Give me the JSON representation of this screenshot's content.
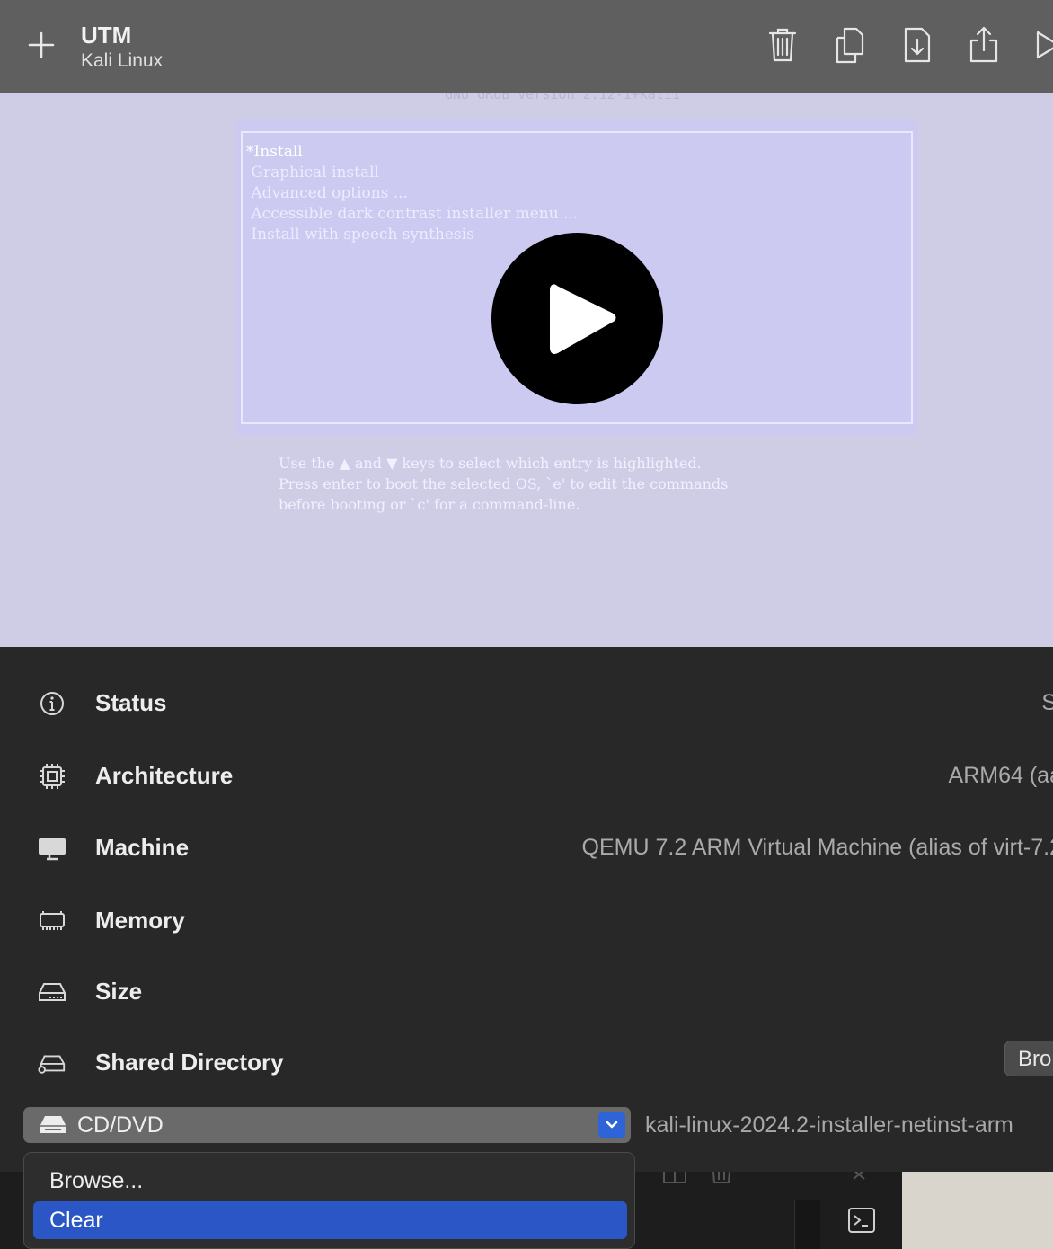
{
  "toolbar": {
    "title": "UTM",
    "subtitle": "Kali Linux",
    "icons": [
      "plus-icon",
      "trash-icon",
      "clone-icon",
      "download-icon",
      "share-icon",
      "run-icon"
    ]
  },
  "vm_screen": {
    "menu_entries": [
      "*Install",
      " Graphical install",
      " Advanced options ...",
      " Accessible dark contrast installer menu ...",
      " Install with speech synthesis"
    ],
    "help_lines": [
      "Use the ▲ and ▼ keys to select which entry is highlighted.",
      "Press enter to boot the selected OS, `e' to edit the commands",
      "before booting or `c' for a command-line."
    ],
    "play_icon": "play-icon"
  },
  "details": {
    "status": {
      "label": "Status",
      "value": "S",
      "icon": "info-icon"
    },
    "architecture": {
      "label": "Architecture",
      "value": "ARM64 (aa",
      "icon": "cpu-icon"
    },
    "machine": {
      "label": "Machine",
      "value": "QEMU 7.2 ARM Virtual Machine (alias of virt-7.2",
      "icon": "display-icon"
    },
    "memory": {
      "label": "Memory",
      "icon": "memory-icon"
    },
    "size": {
      "label": "Size",
      "icon": "drive-icon"
    },
    "shared_directory": {
      "label": "Shared Directory",
      "button": "Bro",
      "icon": "shared-drive-icon"
    }
  },
  "cd_drive": {
    "selected": "CD/DVD",
    "path": "kali-linux-2024.2-installer-netinst-arm",
    "options": [
      "Browse...",
      "Clear"
    ],
    "highlighted_index": 1
  },
  "colors": {
    "accent": "#2a56c6",
    "vm_background": "#cfcde6",
    "panel_background": "#282828"
  }
}
